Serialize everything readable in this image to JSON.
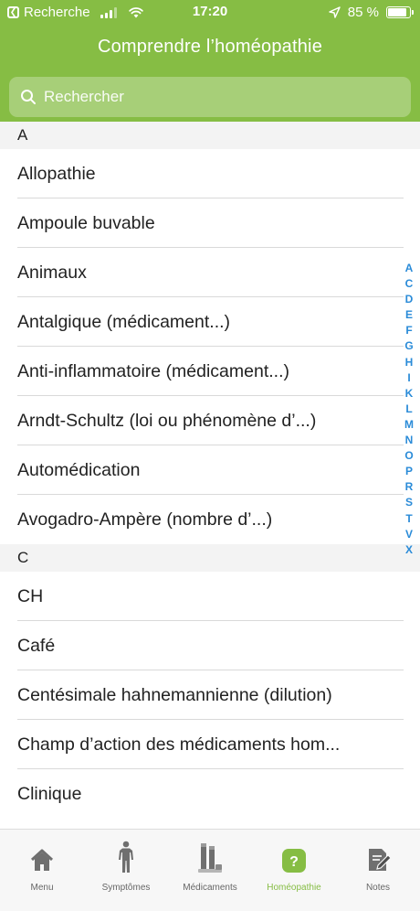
{
  "status_bar": {
    "back_app": "Recherche",
    "time": "17:20",
    "battery": "85 %",
    "battery_level": 0.85
  },
  "header": {
    "title": "Comprendre l’homéopathie"
  },
  "search": {
    "placeholder": "Rechercher"
  },
  "sections": [
    {
      "letter": "A",
      "items": [
        "Allopathie",
        "Ampoule buvable",
        "Animaux",
        "Antalgique (médicament...)",
        "Anti-inflammatoire (médicament...)",
        "Arndt-Schultz (loi ou phénomène d’...)",
        "Automédication",
        "Avogadro-Ampère  (nombre d’...)"
      ]
    },
    {
      "letter": "C",
      "items": [
        "CH",
        "Café",
        "Centésimale hahnemannienne  (dilution)",
        "Champ d’action des médicaments hom...",
        "Clinique"
      ]
    }
  ],
  "index_letters": [
    "A",
    "C",
    "D",
    "E",
    "F",
    "G",
    "H",
    "I",
    "K",
    "L",
    "M",
    "N",
    "O",
    "P",
    "R",
    "S",
    "T",
    "V",
    "X"
  ],
  "tabbar": {
    "tabs": [
      {
        "label": "Menu",
        "icon": "house-icon"
      },
      {
        "label": "Symptômes",
        "icon": "body-icon"
      },
      {
        "label": "Médicaments",
        "icon": "medicine-tubes-icon"
      },
      {
        "label": "Homéopathie",
        "icon": "question-icon"
      },
      {
        "label": "Notes",
        "icon": "note-pencil-icon"
      }
    ],
    "active_index": 3
  },
  "colors": {
    "brand_green": "#86bd44",
    "index_blue": "#2a8bd8",
    "tab_inactive": "#666666"
  }
}
